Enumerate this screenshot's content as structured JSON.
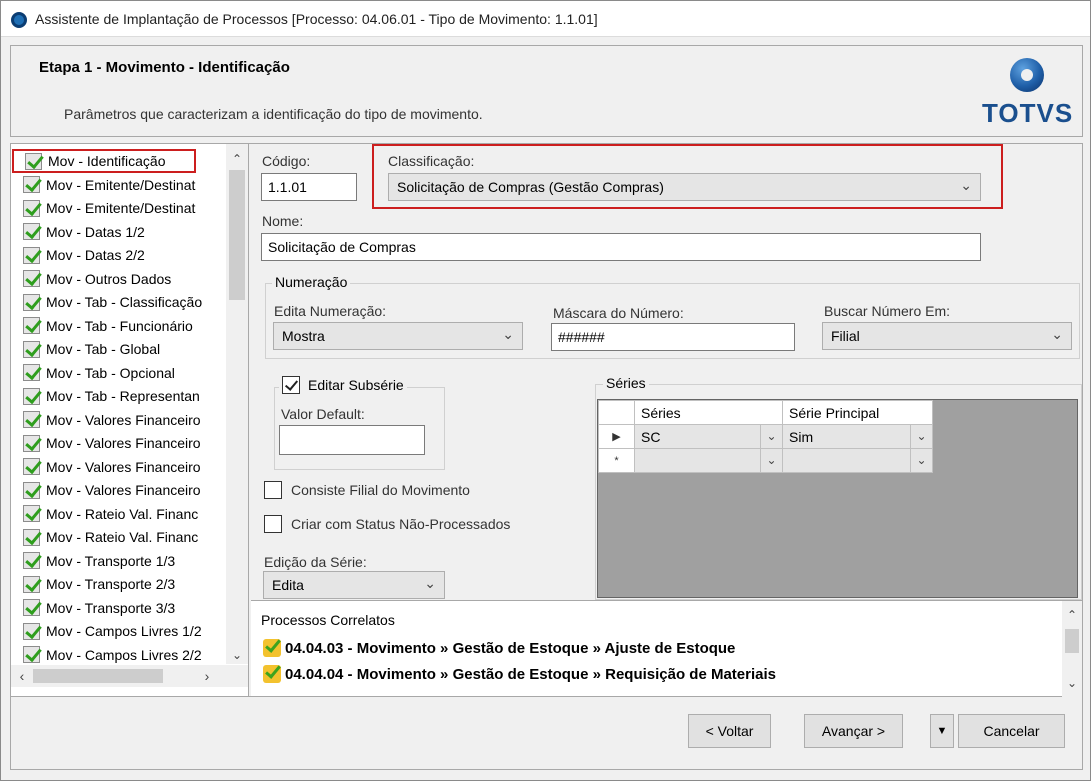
{
  "window": {
    "title": "Assistente de Implantação de Processos [Processo: 04.06.01 - Tipo de Movimento: 1.1.01]"
  },
  "header": {
    "step_title": "Etapa 1 - Movimento - Identificação",
    "step_description": "Parâmetros que caracterizam a identificação do tipo de movimento.",
    "logo_text": "TOTVS"
  },
  "steps": [
    "Mov - Identificação",
    "Mov - Emitente/Destinat",
    "Mov - Emitente/Destinat",
    "Mov - Datas 1/2",
    "Mov - Datas 2/2",
    "Mov - Outros Dados",
    "Mov - Tab - Classificação",
    "Mov - Tab - Funcionário",
    "Mov - Tab - Global",
    "Mov - Tab - Opcional",
    "Mov - Tab - Representan",
    "Mov - Valores Financeiro",
    "Mov - Valores Financeiro",
    "Mov - Valores Financeiro",
    "Mov - Valores Financeiro",
    "Mov - Rateio Val. Financ",
    "Mov - Rateio Val. Financ",
    "Mov - Transporte 1/3",
    "Mov - Transporte 2/3",
    "Mov - Transporte 3/3",
    "Mov - Campos Livres 1/2",
    "Mov - Campos Livres 2/2"
  ],
  "form": {
    "codigo_label": "Código:",
    "codigo_value": "1.1.01",
    "classificacao_label": "Classificação:",
    "classificacao_value": "Solicitação de Compras (Gestão Compras)",
    "nome_label": "Nome:",
    "nome_value": "Solicitação de Compras",
    "numeracao_group": "Numeração",
    "edita_numeracao_label": "Edita Numeração:",
    "edita_numeracao_value": "Mostra",
    "mascara_label": "Máscara do Número:",
    "mascara_value": "######",
    "buscar_label": "Buscar Número Em:",
    "buscar_value": "Filial",
    "editar_subserie_label": "Editar Subsérie",
    "editar_subserie_checked": true,
    "valor_default_label": "Valor Default:",
    "valor_default_value": "",
    "consiste_filial_label": "Consiste Filial do Movimento",
    "consiste_filial_checked": false,
    "criar_status_label": "Criar com Status Não-Processados",
    "criar_status_checked": false,
    "edicao_serie_label": "Edição da Série:",
    "edicao_serie_value": "Edita"
  },
  "series_grid": {
    "group_label": "Séries",
    "columns": [
      "Séries",
      "Série Principal"
    ],
    "rows": [
      {
        "marker": "▶",
        "serie": "SC",
        "principal": "Sim"
      },
      {
        "marker": "*",
        "serie": "",
        "principal": ""
      }
    ]
  },
  "related": {
    "title": "Processos Correlatos",
    "items": [
      "04.04.03 - Movimento » Gestão de Estoque » Ajuste de Estoque",
      "04.04.04 - Movimento » Gestão de Estoque » Requisição de Materiais"
    ]
  },
  "footer": {
    "back_label": "< Voltar",
    "next_label": "Avançar >",
    "cancel_label": "Cancelar"
  }
}
